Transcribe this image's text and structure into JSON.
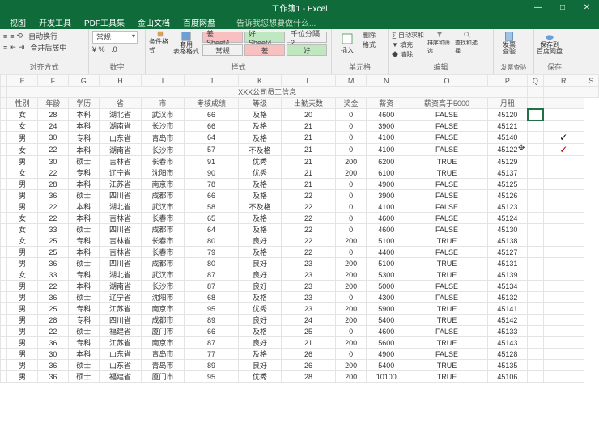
{
  "title": "工作簿1 - Excel",
  "window_controls": {
    "min": "—",
    "max": "□",
    "close": "✕"
  },
  "tabs": [
    "视图",
    "开发工具",
    "PDF工具集",
    "金山文档",
    "百度网盘"
  ],
  "tell_me": "告诉我您想要做什么...",
  "ribbon": {
    "alignment": {
      "wrap": "自动换行",
      "merge": "合并后居中",
      "label": "对齐方式"
    },
    "number": {
      "format": "常规",
      "label": "数字"
    },
    "style": {
      "cond": "条件格式",
      "table": "套用\n表格格式",
      "bad_sheet": "差 Sheet4",
      "good_sheet": "好 Sheet4",
      "thousand": "千位分隔 2",
      "normal": "常规",
      "bad": "差",
      "good": "好",
      "label": "样式"
    },
    "cells": {
      "insert": "插入",
      "delete": "删除",
      "format": "格式",
      "label": "单元格"
    },
    "editing": {
      "sum": "自动求和",
      "fill": "填充",
      "clear": "清除",
      "sort": "排序和筛选",
      "find": "查找和选择",
      "label": "编辑"
    },
    "extra": {
      "bill": "发票\n查验",
      "save": "保存到\n百度网盘",
      "l1": "发票查验",
      "l2": "保存"
    }
  },
  "table_title": "XXX公司员工信息",
  "columns": [
    "",
    "性别",
    "年龄",
    "学历",
    "省",
    "市",
    "考核成绩",
    "等级",
    "出勤天数",
    "奖金",
    "薪资",
    "薪资高于5000",
    "月租",
    "",
    ""
  ],
  "col_letters": [
    "",
    "E",
    "F",
    "G",
    "H",
    "I",
    "J",
    "K",
    "L",
    "M",
    "N",
    "O",
    "P",
    "Q",
    "R",
    "S"
  ],
  "rows": [
    [
      "女",
      "28",
      "本科",
      "湖北省",
      "武汉市",
      "66",
      "及格",
      "20",
      "0",
      "4600",
      "FALSE",
      "45120",
      "",
      ""
    ],
    [
      "女",
      "24",
      "本科",
      "湖南省",
      "长沙市",
      "66",
      "及格",
      "21",
      "0",
      "3900",
      "FALSE",
      "45121",
      "",
      ""
    ],
    [
      "男",
      "30",
      "专科",
      "山东省",
      "青岛市",
      "64",
      "及格",
      "21",
      "0",
      "4100",
      "FALSE",
      "45140",
      "",
      "✓"
    ],
    [
      "女",
      "22",
      "本科",
      "湖南省",
      "长沙市",
      "57",
      "不及格",
      "21",
      "0",
      "4100",
      "FALSE",
      "45122",
      "",
      "✓r"
    ],
    [
      "男",
      "30",
      "硕士",
      "吉林省",
      "长春市",
      "91",
      "优秀",
      "21",
      "200",
      "6200",
      "TRUE",
      "45129",
      "",
      ""
    ],
    [
      "女",
      "22",
      "专科",
      "辽宁省",
      "沈阳市",
      "90",
      "优秀",
      "21",
      "200",
      "6100",
      "TRUE",
      "45137",
      "",
      ""
    ],
    [
      "男",
      "28",
      "本科",
      "江苏省",
      "南京市",
      "78",
      "及格",
      "21",
      "0",
      "4900",
      "FALSE",
      "45125",
      "",
      ""
    ],
    [
      "男",
      "36",
      "硕士",
      "四川省",
      "成都市",
      "66",
      "及格",
      "22",
      "0",
      "3900",
      "FALSE",
      "45126",
      "",
      ""
    ],
    [
      "男",
      "22",
      "本科",
      "湖北省",
      "武汉市",
      "58",
      "不及格",
      "22",
      "0",
      "4100",
      "FALSE",
      "45123",
      "",
      ""
    ],
    [
      "女",
      "22",
      "本科",
      "吉林省",
      "长春市",
      "65",
      "及格",
      "22",
      "0",
      "4600",
      "FALSE",
      "45124",
      "",
      ""
    ],
    [
      "女",
      "33",
      "硕士",
      "四川省",
      "成都市",
      "64",
      "及格",
      "22",
      "0",
      "4600",
      "FALSE",
      "45130",
      "",
      ""
    ],
    [
      "女",
      "25",
      "专科",
      "吉林省",
      "长春市",
      "80",
      "良好",
      "22",
      "200",
      "5100",
      "TRUE",
      "45138",
      "",
      ""
    ],
    [
      "男",
      "25",
      "本科",
      "吉林省",
      "长春市",
      "79",
      "及格",
      "22",
      "0",
      "4400",
      "FALSE",
      "45127",
      "",
      ""
    ],
    [
      "男",
      "36",
      "硕士",
      "四川省",
      "成都市",
      "80",
      "良好",
      "23",
      "200",
      "5100",
      "TRUE",
      "45131",
      "",
      ""
    ],
    [
      "女",
      "33",
      "专科",
      "湖北省",
      "武汉市",
      "87",
      "良好",
      "23",
      "200",
      "5300",
      "TRUE",
      "45139",
      "",
      ""
    ],
    [
      "男",
      "22",
      "本科",
      "湖南省",
      "长沙市",
      "87",
      "良好",
      "23",
      "200",
      "5000",
      "FALSE",
      "45134",
      "",
      ""
    ],
    [
      "男",
      "36",
      "硕士",
      "辽宁省",
      "沈阳市",
      "68",
      "及格",
      "23",
      "0",
      "4300",
      "FALSE",
      "45132",
      "",
      ""
    ],
    [
      "男",
      "25",
      "专科",
      "江苏省",
      "南京市",
      "95",
      "优秀",
      "23",
      "200",
      "5900",
      "TRUE",
      "45141",
      "",
      ""
    ],
    [
      "男",
      "28",
      "专科",
      "四川省",
      "成都市",
      "89",
      "良好",
      "24",
      "200",
      "5400",
      "TRUE",
      "45142",
      "",
      ""
    ],
    [
      "男",
      "22",
      "硕士",
      "福建省",
      "厦门市",
      "66",
      "及格",
      "25",
      "0",
      "4600",
      "FALSE",
      "45133",
      "",
      ""
    ],
    [
      "男",
      "36",
      "专科",
      "江苏省",
      "南京市",
      "87",
      "良好",
      "21",
      "200",
      "5600",
      "TRUE",
      "45143",
      "",
      ""
    ],
    [
      "男",
      "30",
      "本科",
      "山东省",
      "青岛市",
      "77",
      "及格",
      "26",
      "0",
      "4900",
      "FALSE",
      "45128",
      "",
      ""
    ],
    [
      "男",
      "36",
      "硕士",
      "山东省",
      "青岛市",
      "89",
      "良好",
      "26",
      "200",
      "5400",
      "TRUE",
      "45135",
      "",
      ""
    ],
    [
      "男",
      "36",
      "硕士",
      "福建省",
      "厦门市",
      "95",
      "优秀",
      "28",
      "200",
      "10100",
      "TRUE",
      "45106",
      "",
      ""
    ]
  ],
  "selected_cell": {
    "row": 0,
    "col": 12
  },
  "cursor_cell": {
    "row": 3,
    "col": 12
  },
  "chart_data": {
    "type": "table",
    "title": "XXX公司员工信息",
    "columns": [
      "性别",
      "年龄",
      "学历",
      "省",
      "市",
      "考核成绩",
      "等级",
      "出勤天数",
      "奖金",
      "薪资",
      "薪资高于5000",
      "月租"
    ],
    "rows": [
      [
        "女",
        28,
        "本科",
        "湖北省",
        "武汉市",
        66,
        "及格",
        20,
        0,
        4600,
        false,
        45120
      ],
      [
        "女",
        24,
        "本科",
        "湖南省",
        "长沙市",
        66,
        "及格",
        21,
        0,
        3900,
        false,
        45121
      ],
      [
        "男",
        30,
        "专科",
        "山东省",
        "青岛市",
        64,
        "及格",
        21,
        0,
        4100,
        false,
        45140
      ],
      [
        "女",
        22,
        "本科",
        "湖南省",
        "长沙市",
        57,
        "不及格",
        21,
        0,
        4100,
        false,
        45122
      ],
      [
        "男",
        30,
        "硕士",
        "吉林省",
        "长春市",
        91,
        "优秀",
        21,
        200,
        6200,
        true,
        45129
      ],
      [
        "女",
        22,
        "专科",
        "辽宁省",
        "沈阳市",
        90,
        "优秀",
        21,
        200,
        6100,
        true,
        45137
      ],
      [
        "男",
        28,
        "本科",
        "江苏省",
        "南京市",
        78,
        "及格",
        21,
        0,
        4900,
        false,
        45125
      ],
      [
        "男",
        36,
        "硕士",
        "四川省",
        "成都市",
        66,
        "及格",
        22,
        0,
        3900,
        false,
        45126
      ],
      [
        "男",
        22,
        "本科",
        "湖北省",
        "武汉市",
        58,
        "不及格",
        22,
        0,
        4100,
        false,
        45123
      ],
      [
        "女",
        22,
        "本科",
        "吉林省",
        "长春市",
        65,
        "及格",
        22,
        0,
        4600,
        false,
        45124
      ],
      [
        "女",
        33,
        "硕士",
        "四川省",
        "成都市",
        64,
        "及格",
        22,
        0,
        4600,
        false,
        45130
      ],
      [
        "女",
        25,
        "专科",
        "吉林省",
        "长春市",
        80,
        "良好",
        22,
        200,
        5100,
        true,
        45138
      ],
      [
        "男",
        25,
        "本科",
        "吉林省",
        "长春市",
        79,
        "及格",
        22,
        0,
        4400,
        false,
        45127
      ],
      [
        "男",
        36,
        "硕士",
        "四川省",
        "成都市",
        80,
        "良好",
        23,
        200,
        5100,
        true,
        45131
      ],
      [
        "女",
        33,
        "专科",
        "湖北省",
        "武汉市",
        87,
        "良好",
        23,
        200,
        5300,
        true,
        45139
      ],
      [
        "男",
        22,
        "本科",
        "湖南省",
        "长沙市",
        87,
        "良好",
        23,
        200,
        5000,
        false,
        45134
      ],
      [
        "男",
        36,
        "硕士",
        "辽宁省",
        "沈阳市",
        68,
        "及格",
        23,
        0,
        4300,
        false,
        45132
      ],
      [
        "男",
        25,
        "专科",
        "江苏省",
        "南京市",
        95,
        "优秀",
        23,
        200,
        5900,
        true,
        45141
      ],
      [
        "男",
        28,
        "专科",
        "四川省",
        "成都市",
        89,
        "良好",
        24,
        200,
        5400,
        true,
        45142
      ],
      [
        "男",
        22,
        "硕士",
        "福建省",
        "厦门市",
        66,
        "及格",
        25,
        0,
        4600,
        false,
        45133
      ],
      [
        "男",
        36,
        "专科",
        "江苏省",
        "南京市",
        87,
        "良好",
        21,
        200,
        5600,
        true,
        45143
      ],
      [
        "男",
        30,
        "本科",
        "山东省",
        "青岛市",
        77,
        "及格",
        26,
        0,
        4900,
        false,
        45128
      ],
      [
        "男",
        36,
        "硕士",
        "山东省",
        "青岛市",
        89,
        "良好",
        26,
        200,
        5400,
        true,
        45135
      ],
      [
        "男",
        36,
        "硕士",
        "福建省",
        "厦门市",
        95,
        "优秀",
        28,
        200,
        10100,
        true,
        45106
      ]
    ]
  }
}
